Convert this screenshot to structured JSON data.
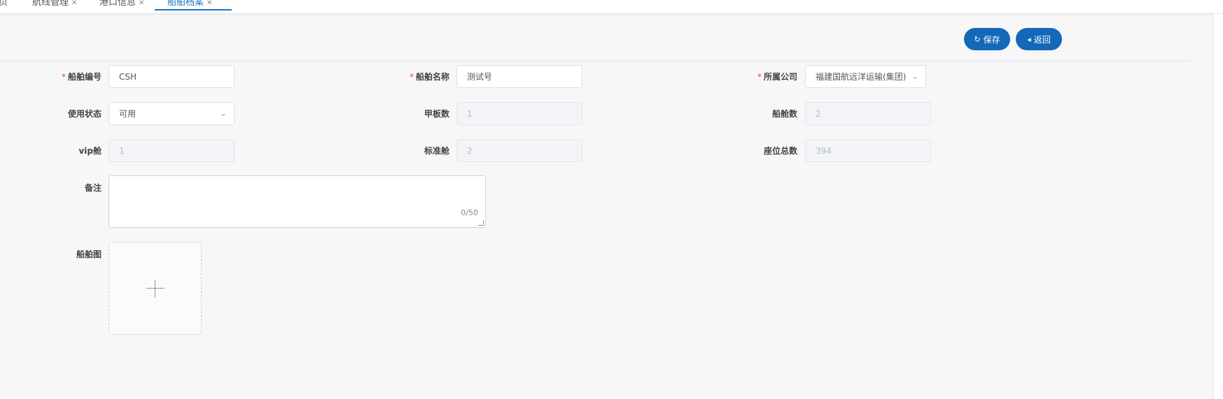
{
  "tabs": [
    {
      "label": "页",
      "active": false
    },
    {
      "label": "航线管理",
      "active": false
    },
    {
      "label": "港口信息",
      "active": false
    },
    {
      "label": "船舶档案",
      "active": true
    }
  ],
  "toolbar": {
    "save_label": "保存",
    "back_label": "返回",
    "save_icon": "refresh-icon",
    "back_icon": "caret-left-icon"
  },
  "form": {
    "ship_code": {
      "label": "船舶编号",
      "value": "CSH",
      "required": true
    },
    "ship_name": {
      "label": "船舶名称",
      "value": "测试号",
      "required": true
    },
    "company": {
      "label": "所属公司",
      "value": "福建国航远洋运输(集团)股份",
      "required": true
    },
    "status": {
      "label": "使用状态",
      "value": "可用"
    },
    "deck_count": {
      "label": "甲板数",
      "value": "1"
    },
    "cabin_count": {
      "label": "船舱数",
      "value": "2"
    },
    "vip_cabin": {
      "label": "vip舱",
      "value": "1"
    },
    "standard_cabin": {
      "label": "标准舱",
      "value": "2"
    },
    "total_seats": {
      "label": "座位总数",
      "value": "394"
    },
    "remark": {
      "label": "备注",
      "value": "",
      "counter": "0/50"
    },
    "ship_image": {
      "label": "船舶图"
    }
  },
  "colors": {
    "primary": "#1368b8",
    "required": "#e84b3c",
    "background": "#f7f7f8"
  }
}
